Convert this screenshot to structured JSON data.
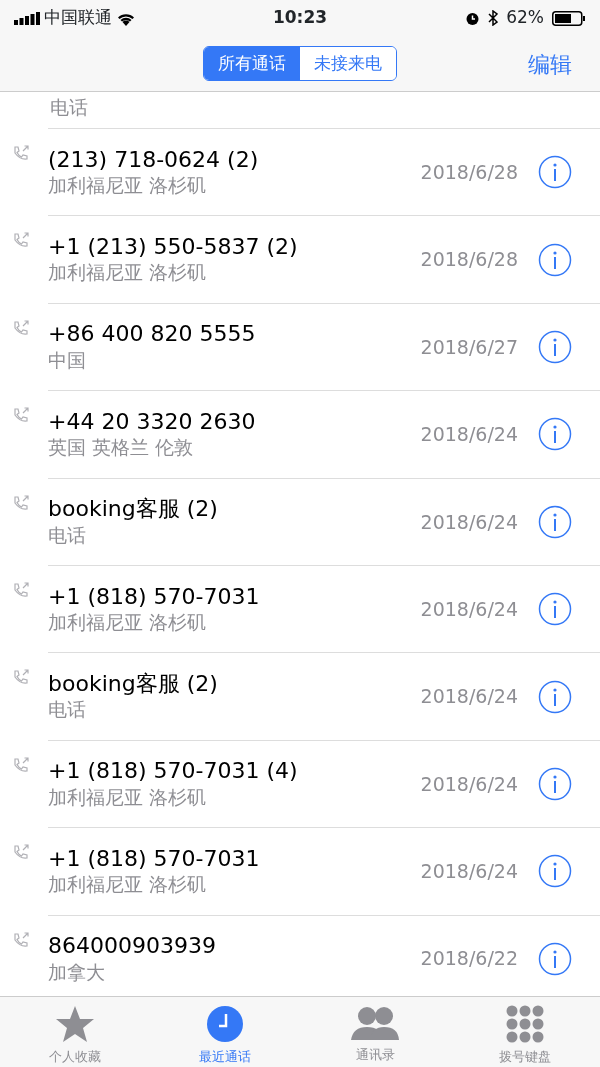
{
  "status_bar": {
    "carrier": "中国联通",
    "time": "10:23",
    "battery": "62%"
  },
  "nav": {
    "segments": [
      {
        "label": "所有通话",
        "selected": true
      },
      {
        "label": "未接来电",
        "selected": false
      }
    ],
    "edit": "编辑"
  },
  "partial_row": {
    "subtitle": "电话"
  },
  "calls": [
    {
      "title": "(213) 718-0624 (2)",
      "subtitle": "加利福尼亚 洛杉矶",
      "date": "2018/6/28"
    },
    {
      "title": "+1 (213) 550-5837 (2)",
      "subtitle": "加利福尼亚 洛杉矶",
      "date": "2018/6/28"
    },
    {
      "title": "+86 400 820 5555",
      "subtitle": "中国",
      "date": "2018/6/27"
    },
    {
      "title": "+44 20 3320 2630",
      "subtitle": "英国 英格兰 伦敦",
      "date": "2018/6/24"
    },
    {
      "title": "booking客服 (2)",
      "subtitle": "电话",
      "date": "2018/6/24"
    },
    {
      "title": "+1 (818) 570-7031",
      "subtitle": "加利福尼亚 洛杉矶",
      "date": "2018/6/24"
    },
    {
      "title": "booking客服 (2)",
      "subtitle": "电话",
      "date": "2018/6/24"
    },
    {
      "title": "+1 (818) 570-7031 (4)",
      "subtitle": "加利福尼亚 洛杉矶",
      "date": "2018/6/24"
    },
    {
      "title": "+1 (818) 570-7031",
      "subtitle": "加利福尼亚 洛杉矶",
      "date": "2018/6/24"
    },
    {
      "title": "864000903939",
      "subtitle": "加拿大",
      "date": "2018/6/22"
    }
  ],
  "tab_bar": [
    {
      "label": "个人收藏",
      "kind": "star",
      "selected": false
    },
    {
      "label": "最近通话",
      "kind": "clock",
      "selected": true
    },
    {
      "label": "通讯录",
      "kind": "contacts",
      "selected": false
    },
    {
      "label": "拨号键盘",
      "kind": "keypad",
      "selected": false
    }
  ]
}
